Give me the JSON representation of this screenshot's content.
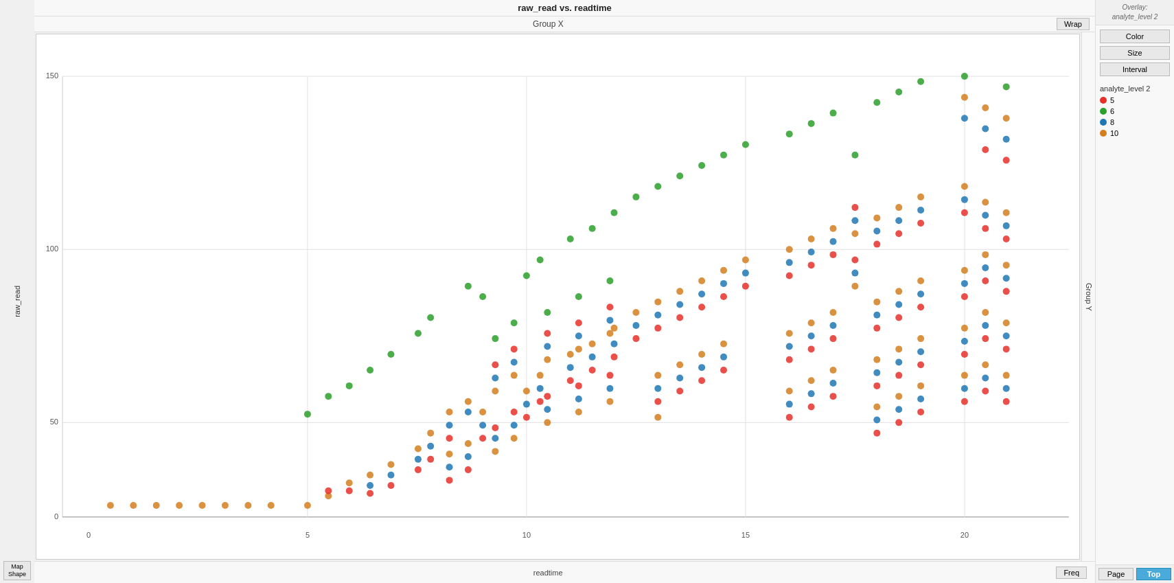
{
  "chart": {
    "title": "raw_read vs. readtime",
    "groupX": "Group X",
    "groupY": "Group Y",
    "xAxisLabel": "readtime",
    "yAxisLabel": "raw_read",
    "wrap": "Wrap",
    "overlay": {
      "header": "Overlay:\nanalyte_level 2"
    }
  },
  "buttons": {
    "color": "Color",
    "size": "Size",
    "interval": "Interval",
    "mapShape": "Map\nShape",
    "freq": "Freq",
    "page": "Page",
    "top": "Top"
  },
  "legend": {
    "title": "analyte_level 2",
    "items": [
      {
        "label": "5",
        "color": "#e8302a"
      },
      {
        "label": "6",
        "color": "#2ca02c"
      },
      {
        "label": "8",
        "color": "#1f77b4"
      },
      {
        "label": "10",
        "color": "#d47f1e"
      }
    ]
  },
  "yAxis": {
    "ticks": [
      "0",
      "50",
      "100",
      "150"
    ]
  },
  "xAxis": {
    "ticks": [
      "0",
      "5",
      "10",
      "15",
      "20"
    ]
  }
}
